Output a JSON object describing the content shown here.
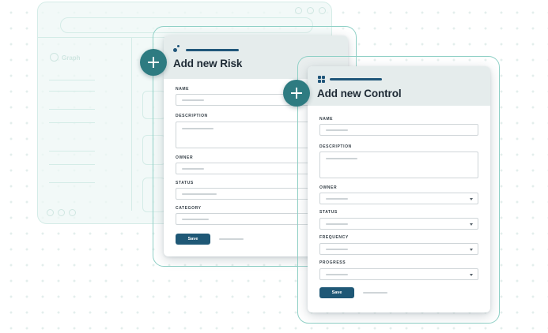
{
  "background_app": {
    "brand": "Graph"
  },
  "risk_form": {
    "title": "Add new Risk",
    "fields": {
      "name": "NAME",
      "description": "DESCRIPTION",
      "owner": "OWNER",
      "status": "STATUS",
      "category": "CATEGORY"
    },
    "save_label": "Save"
  },
  "control_form": {
    "title": "Add new Control",
    "fields": {
      "name": "NAME",
      "description": "DESCRIPTION",
      "owner": "OWNER",
      "status": "STATUS",
      "frequency": "FREQUENCY",
      "progress": "PROGRESS"
    },
    "save_label": "Save"
  },
  "colors": {
    "accent_teal": "#2e7b81",
    "primary_navy": "#1f5876",
    "frame_teal": "#8fd0c6",
    "header_gray": "#e5ecec"
  },
  "icons": [
    "plus-icon",
    "risk-dots-icon",
    "control-grid-icon",
    "chevron-down-icon"
  ]
}
